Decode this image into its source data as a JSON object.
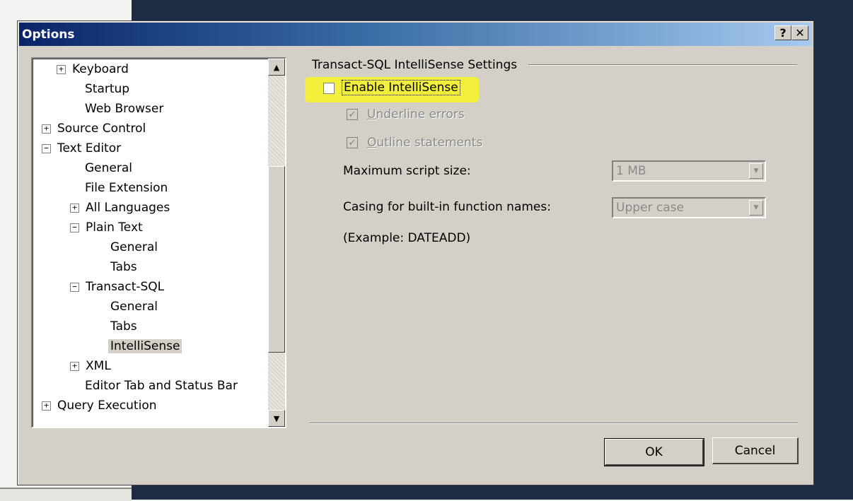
{
  "dialog": {
    "title": "Options",
    "help_label": "?",
    "close_label": "✕"
  },
  "tree": {
    "items": [
      {
        "label": "Keyboard",
        "expander": "+"
      },
      {
        "label": "Startup"
      },
      {
        "label": "Web Browser"
      },
      {
        "label": "Source Control",
        "expander": "+"
      },
      {
        "label": "Text Editor",
        "expander": "−"
      },
      {
        "label": "General"
      },
      {
        "label": "File Extension"
      },
      {
        "label": "All Languages",
        "expander": "+"
      },
      {
        "label": "Plain Text",
        "expander": "−"
      },
      {
        "label": "General"
      },
      {
        "label": "Tabs"
      },
      {
        "label": "Transact-SQL",
        "expander": "−"
      },
      {
        "label": "General"
      },
      {
        "label": "Tabs"
      },
      {
        "label": "IntelliSense",
        "selected": true
      },
      {
        "label": "XML",
        "expander": "+"
      },
      {
        "label": "Editor Tab and Status Bar"
      },
      {
        "label": "Query Execution",
        "expander": "+"
      }
    ],
    "scroll_up": "▲",
    "scroll_down": "▼"
  },
  "settings": {
    "group_title": "Transact-SQL IntelliSense Settings",
    "enable_intellisense": {
      "label": "Enable IntelliSense",
      "checked": false
    },
    "underline_errors": {
      "label_u": "U",
      "label_rest": "nderline errors",
      "checked": true,
      "enabled": false
    },
    "outline_statements": {
      "label_u": "O",
      "label_rest": "utline statements",
      "checked": true,
      "enabled": false
    },
    "max_script_size": {
      "label": "Maximum script size:",
      "value": "1 MB"
    },
    "casing": {
      "label": "Casing for built-in function names:",
      "value": "Upper case"
    },
    "example": "(Example: DATEADD)",
    "check_glyph": "✓",
    "dropdown_glyph": "▼"
  },
  "buttons": {
    "ok": "OK",
    "cancel": "Cancel"
  },
  "colors": {
    "titlebar_start": "#0a246a",
    "titlebar_end": "#a6caf0",
    "highlight": "#f2f03a",
    "dialog_face": "#d4d0c8"
  }
}
